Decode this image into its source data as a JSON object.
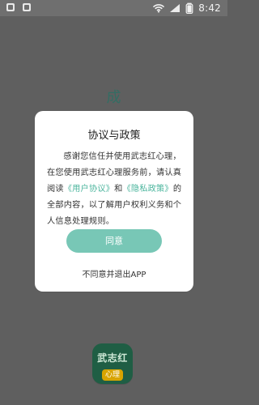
{
  "status_bar": {
    "time": "8:42"
  },
  "background": {
    "hint_text": "成"
  },
  "dialog": {
    "title": "协议与政策",
    "body_prefix": "感谢您信任并使用武志红心理，在您使用武志红心理服务前，请认真阅读",
    "user_agreement_link": "《用户协议》",
    "and_text": "和",
    "privacy_policy_link": "《隐私政策》",
    "body_suffix": "的全部内容，以了解用户权利义务和个人信息处理规则。",
    "primary_button": "同意",
    "secondary_link": "不同意并退出APP"
  },
  "app_icon": {
    "top_text": "武志红",
    "badge_text": "心理"
  },
  "colors": {
    "accent": "#78c7b6",
    "link": "#4bb59d",
    "overlay": "#5f5f5f",
    "dialog": "#ffffff"
  }
}
